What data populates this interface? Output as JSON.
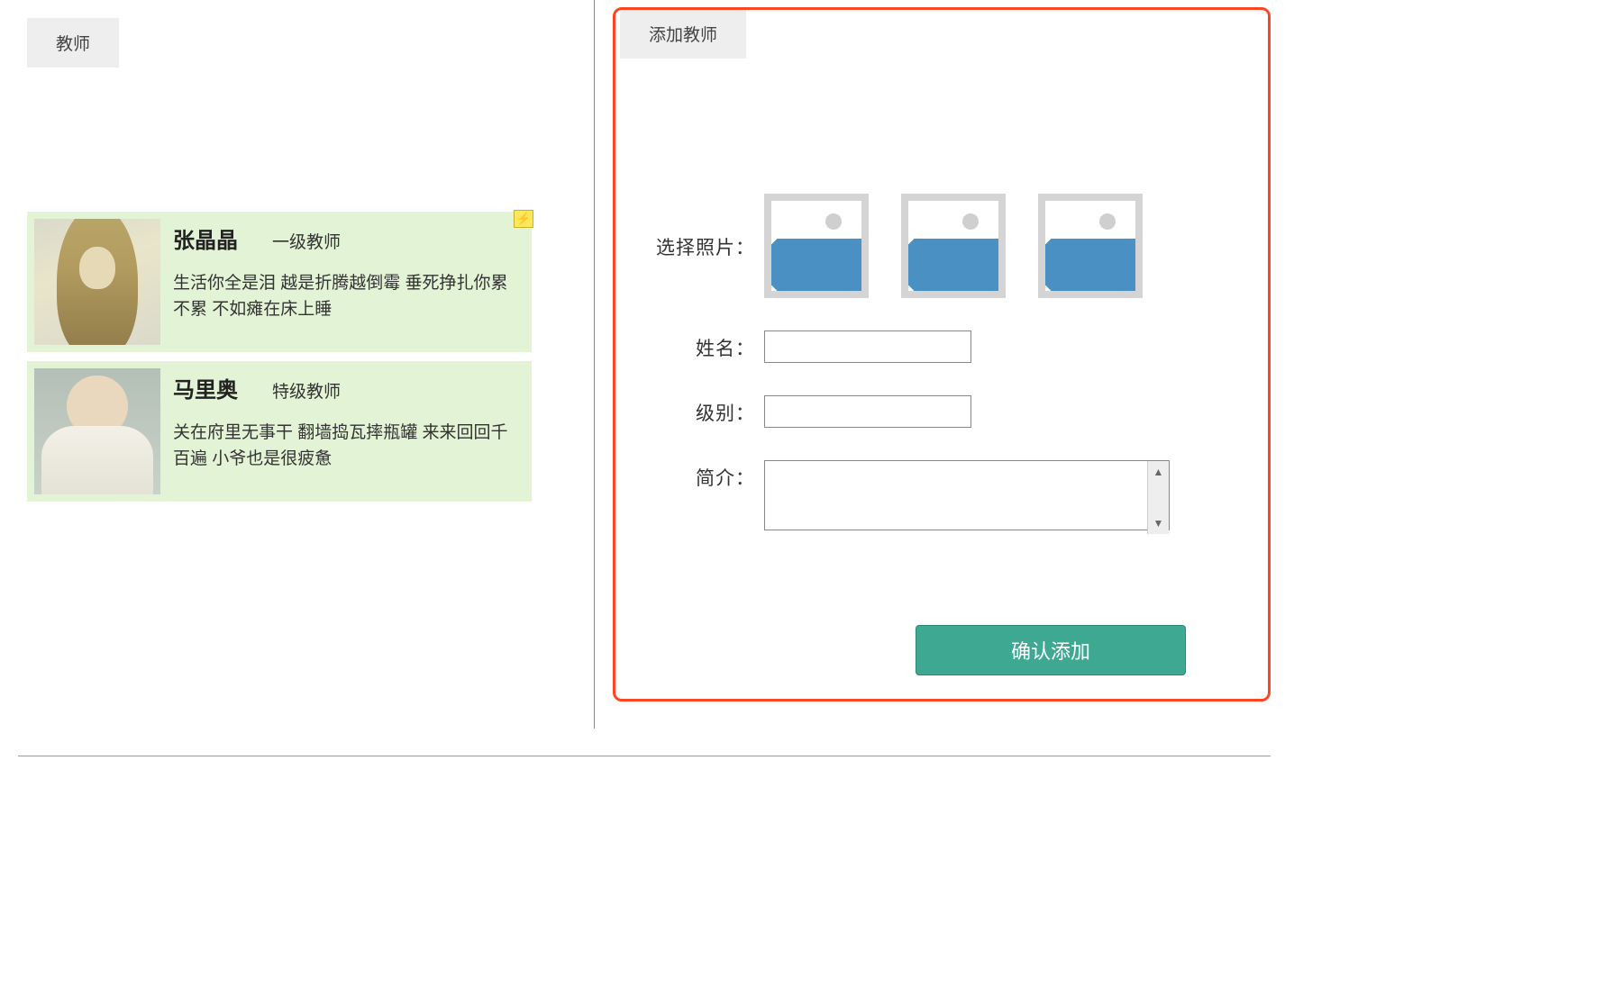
{
  "left": {
    "title": "教师",
    "teachers": [
      {
        "name": "张晶晶",
        "level": "一级教师",
        "desc": "生活你全是泪  越是折腾越倒霉  垂死挣扎你累不累  不如瘫在床上睡"
      },
      {
        "name": "马里奥",
        "level": "特级教师",
        "desc": "关在府里无事干  翻墙捣瓦摔瓶罐  来来回回千百遍  小爷也是很疲惫"
      }
    ]
  },
  "right": {
    "title": "添加教师",
    "labels": {
      "photo": "选择照片：",
      "name": "姓名：",
      "level": "级别：",
      "intro": "简介："
    },
    "fields": {
      "name": "",
      "level": "",
      "intro": ""
    },
    "submit": "确认添加"
  }
}
